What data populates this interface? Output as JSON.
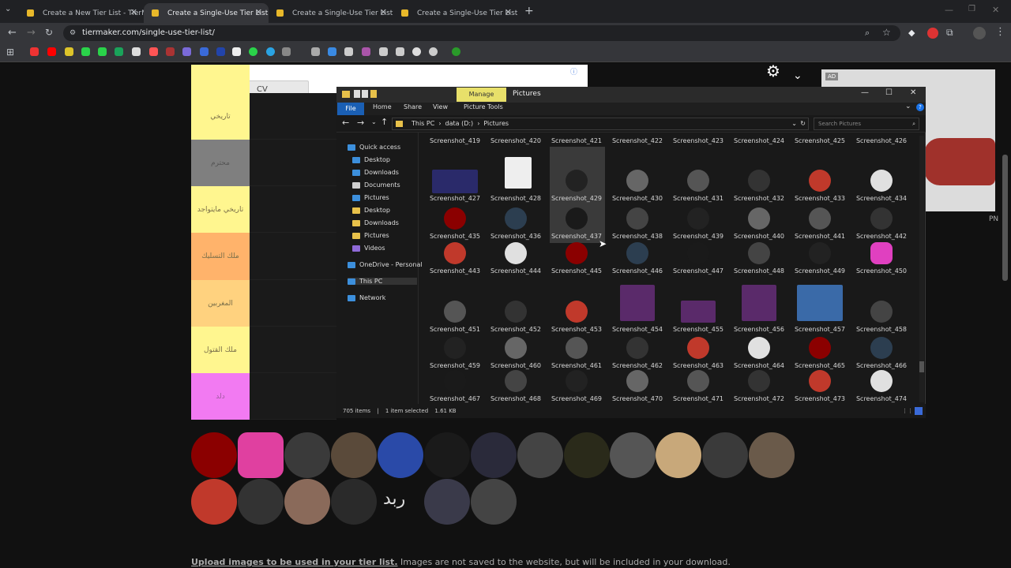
{
  "browser": {
    "tabs": [
      {
        "title": "Create a New Tier List - TierMa",
        "active": false
      },
      {
        "title": "Create a Single-Use Tier List (P",
        "active": true
      },
      {
        "title": "Create a Single-Use Tier List (P",
        "active": false
      },
      {
        "title": "Create a Single-Use Tier List (P",
        "active": false
      }
    ],
    "url": "tiermaker.com/single-use-tier-list/"
  },
  "ad": {
    "badge": "AD",
    "badge2": "AD",
    "template_button": "CV\nTemplate",
    "right_label": "PN"
  },
  "tiers": [
    {
      "label": "",
      "color": "#fff68f"
    },
    {
      "label": "تاريخي",
      "color": "#fff68f"
    },
    {
      "label": "محترم",
      "color": "#7f7f7f"
    },
    {
      "label": "تاريخي مايتواجد",
      "color": "#fff68f"
    },
    {
      "label": "ملك التسليك",
      "color": "#ffb36b"
    },
    {
      "label": "المغربين",
      "color": "#ffd27f"
    },
    {
      "label": "ملك القتول",
      "color": "#fff68f"
    },
    {
      "label": "دلد",
      "color": "#f27af2"
    }
  ],
  "explorer": {
    "ribbon_manage": "Manage",
    "title": "Pictures",
    "menu": [
      "File",
      "Home",
      "Share",
      "View",
      "Picture Tools"
    ],
    "breadcrumb": [
      "This PC",
      "data (D:)",
      "Pictures"
    ],
    "search_placeholder": "Search Pictures",
    "nav": [
      {
        "label": "Quick access",
        "color": "#3c8fdc"
      },
      {
        "label": "Desktop",
        "color": "#3c8fdc"
      },
      {
        "label": "Downloads",
        "color": "#3c8fdc"
      },
      {
        "label": "Documents",
        "color": "#cfcfcf"
      },
      {
        "label": "Pictures",
        "color": "#3c8fdc"
      },
      {
        "label": "Desktop",
        "color": "#e8c14a"
      },
      {
        "label": "Downloads",
        "color": "#e8c14a"
      },
      {
        "label": "Pictures",
        "color": "#e8c14a"
      },
      {
        "label": "Videos",
        "color": "#8f6ad8"
      },
      {
        "label": "OneDrive - Personal",
        "color": "#3c8fdc"
      },
      {
        "label": "This PC",
        "color": "#3c8fdc"
      },
      {
        "label": "Network",
        "color": "#3c8fdc"
      }
    ],
    "files": [
      "Screenshot_419",
      "Screenshot_420",
      "Screenshot_421",
      "Screenshot_422",
      "Screenshot_423",
      "Screenshot_424",
      "Screenshot_425",
      "Screenshot_426",
      "Screenshot_427",
      "Screenshot_428",
      "Screenshot_429",
      "Screenshot_430",
      "Screenshot_431",
      "Screenshot_432",
      "Screenshot_433",
      "Screenshot_434",
      "Screenshot_435",
      "Screenshot_436",
      "Screenshot_437",
      "Screenshot_438",
      "Screenshot_439",
      "Screenshot_440",
      "Screenshot_441",
      "Screenshot_442",
      "Screenshot_443",
      "Screenshot_444",
      "Screenshot_445",
      "Screenshot_446",
      "Screenshot_447",
      "Screenshot_448",
      "Screenshot_449",
      "Screenshot_450",
      "Screenshot_451",
      "Screenshot_452",
      "Screenshot_453",
      "Screenshot_454",
      "Screenshot_455",
      "Screenshot_456",
      "Screenshot_457",
      "Screenshot_458",
      "Screenshot_459",
      "Screenshot_460",
      "Screenshot_461",
      "Screenshot_462",
      "Screenshot_463",
      "Screenshot_464",
      "Screenshot_465",
      "Screenshot_466",
      "Screenshot_467",
      "Screenshot_468",
      "Screenshot_469",
      "Screenshot_470",
      "Screenshot_471",
      "Screenshot_472",
      "Screenshot_473",
      "Screenshot_474"
    ],
    "status_items": "705 items",
    "status_selected": "1 item selected",
    "status_size": "1.61 KB"
  },
  "upload_note": {
    "bold": "Upload images to be used in your tier list.",
    "rest": " Images are not saved to the website, but will be included in your download."
  },
  "avatar_text": "ربد"
}
